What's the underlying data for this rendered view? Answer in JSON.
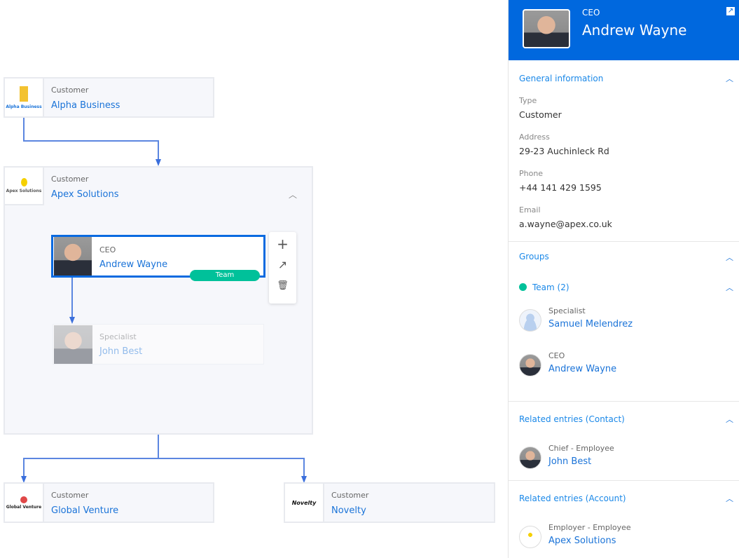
{
  "diagram": {
    "nodes": {
      "alpha": {
        "type": "Customer",
        "name": "Alpha Business",
        "logo_text": "Alpha Business"
      },
      "apex": {
        "type": "Customer",
        "name": "Apex Solutions",
        "logo_text": "Apex Solutions"
      },
      "ceo": {
        "role": "CEO",
        "name": "Andrew Wayne",
        "badge": "Team"
      },
      "specialist": {
        "role": "Specialist",
        "name": "John Best"
      },
      "global": {
        "type": "Customer",
        "name": "Global Venture",
        "logo_text": "Global Venture"
      },
      "novelty": {
        "type": "Customer",
        "name": "Novelty",
        "logo_text": "Novelty"
      }
    },
    "toolbar": {
      "add": "+",
      "connect": "↗",
      "delete": "🗑"
    }
  },
  "panel": {
    "header": {
      "role": "CEO",
      "name": "Andrew Wayne"
    },
    "general": {
      "title": "General information",
      "type_label": "Type",
      "type_value": "Customer",
      "address_label": "Address",
      "address_value": "29-23 Auchinleck Rd",
      "phone_label": "Phone",
      "phone_value": "+44 141 429 1595",
      "email_label": "Email",
      "email_value": "a.wayne@apex.co.uk"
    },
    "groups": {
      "title": "Groups",
      "team_label": "Team (2)",
      "members": [
        {
          "role": "Specialist",
          "name": "Samuel Melendrez"
        },
        {
          "role": "CEO",
          "name": "Andrew Wayne"
        }
      ]
    },
    "related_contact": {
      "title": "Related entries (Contact)",
      "role": "Chief - Employee",
      "name": "John Best"
    },
    "related_account": {
      "title": "Related entries (Account)",
      "role": "Employer - Employee",
      "name": "Apex Solutions"
    }
  },
  "colors": {
    "accent": "#0068de",
    "team": "#00c19a",
    "link": "#1a73d8"
  }
}
